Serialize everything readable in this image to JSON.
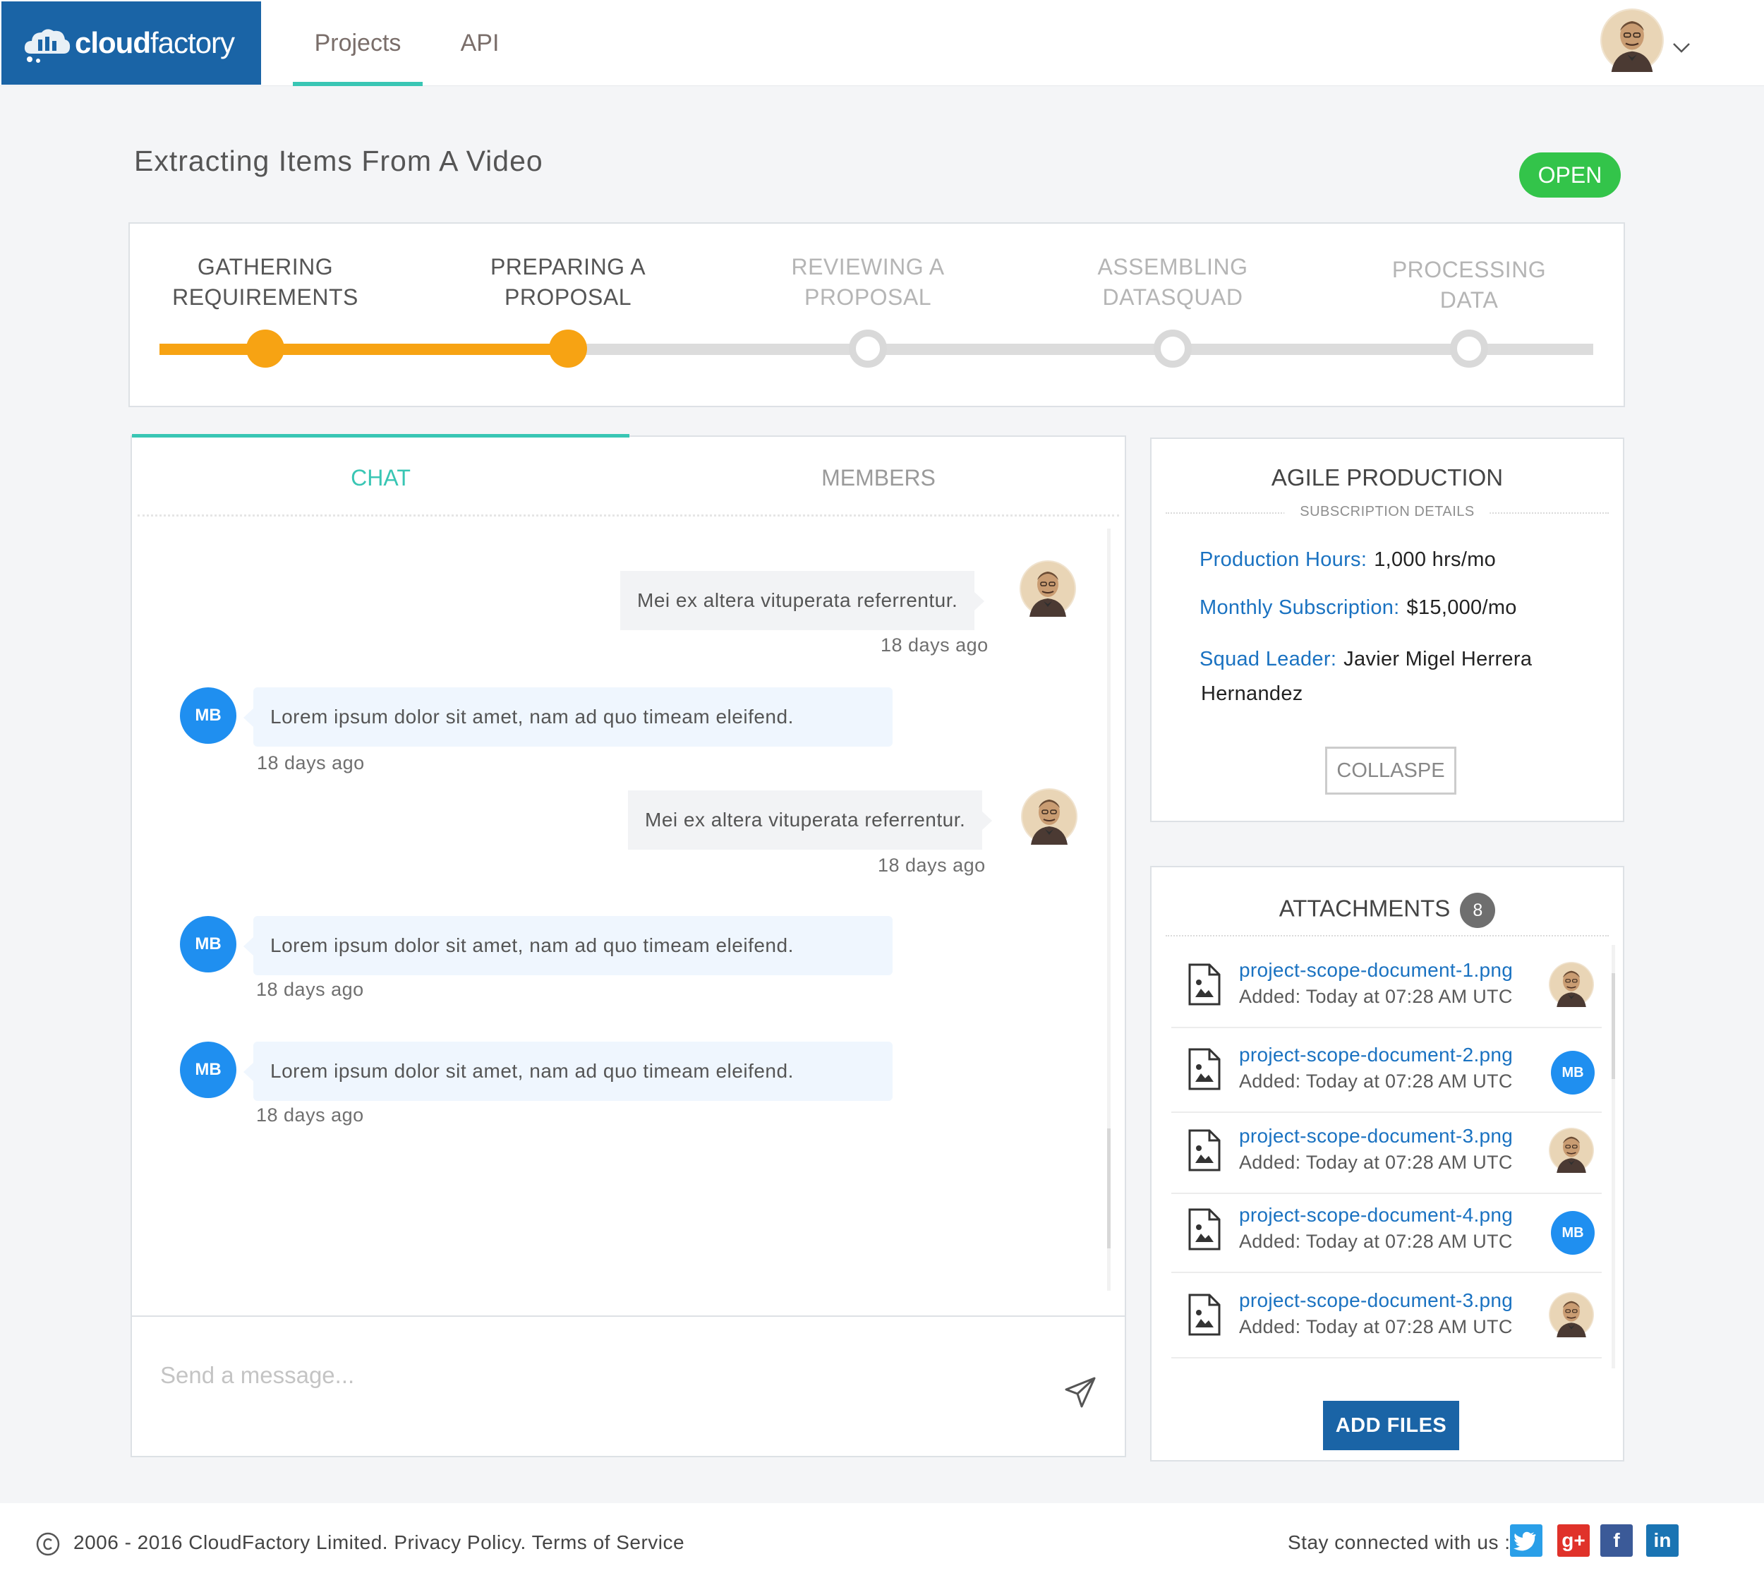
{
  "header": {
    "logo_text_bold": "cloud",
    "logo_text_rest": "factory",
    "nav": [
      {
        "label": "Projects",
        "active": true
      },
      {
        "label": "API",
        "active": false
      }
    ],
    "accent_color": "#39c6b4",
    "brand_color": "#1a64a6"
  },
  "project": {
    "title": "Extracting Items From A Video",
    "status": "OPEN",
    "status_color": "#33c44a"
  },
  "stepper": {
    "progress_fraction": 0.29,
    "steps": [
      {
        "line1": "GATHERING",
        "line2": "REQUIREMENTS",
        "done": true
      },
      {
        "line1": "PREPARING A",
        "line2": "PROPOSAL",
        "done": true
      },
      {
        "line1": "REVIEWING A",
        "line2": "PROPOSAL",
        "done": false
      },
      {
        "line1": "ASSEMBLING",
        "line2": "DATASQUAD",
        "done": false
      },
      {
        "line1": "PROCESSING",
        "line2": "DATA",
        "done": false
      }
    ]
  },
  "chat": {
    "tabs": [
      {
        "label": "CHAT",
        "active": true
      },
      {
        "label": "MEMBERS",
        "active": false
      }
    ],
    "messages": [
      {
        "text": "Mei ex altera vituperata referrentur.",
        "time": "18 days ago",
        "mine": true
      },
      {
        "text": "Lorem ipsum dolor sit amet, nam ad quo timeam eleifend.",
        "time": "18 days ago",
        "mine": false,
        "initials": "MB"
      },
      {
        "text": "Mei ex altera vituperata referrentur.",
        "time": "18 days ago",
        "mine": true
      },
      {
        "text": "Lorem ipsum dolor sit amet, nam ad quo timeam eleifend.",
        "time": "18 days ago",
        "mine": false,
        "initials": "MB"
      },
      {
        "text": "Lorem ipsum dolor sit amet, nam ad quo timeam eleifend.",
        "time": "18 days ago",
        "mine": false,
        "initials": "MB"
      }
    ],
    "compose_placeholder": "Send a message..."
  },
  "subscription": {
    "title": "AGILE PRODUCTION",
    "subtitle": "SUBSCRIPTION DETAILS",
    "details": [
      {
        "label": "Production Hours:",
        "value": "1,000 hrs/mo"
      },
      {
        "label": "Monthly Subscription:",
        "value": "$15,000/mo"
      },
      {
        "label": "Squad Leader:",
        "value": "Javier Migel Herrera"
      }
    ],
    "squad_leader_cont": "Hernandez",
    "collapse_label": "COLLASPE"
  },
  "attachments": {
    "title": "ATTACHMENTS",
    "count": "8",
    "items": [
      {
        "name": "project-scope-document-1.png",
        "added": "Added: Today at 07:28 AM UTC",
        "owner": "photo"
      },
      {
        "name": "project-scope-document-2.png",
        "added": "Added: Today at 07:28 AM UTC",
        "owner": "MB"
      },
      {
        "name": "project-scope-document-3.png",
        "added": "Added: Today at 07:28 AM UTC",
        "owner": "photo"
      },
      {
        "name": "project-scope-document-4.png",
        "added": "Added: Today at 07:28 AM UTC",
        "owner": "MB"
      },
      {
        "name": "project-scope-document-3.png",
        "added": "Added: Today at 07:28 AM UTC",
        "owner": "photo"
      }
    ],
    "add_files_label": "ADD FILES"
  },
  "footer": {
    "copyright": "2006 - 2016 CloudFactory Limited. Privacy Policy. Terms of Service",
    "social_label": "Stay connected with us :",
    "social_icons": [
      "twitter-icon",
      "google-plus-icon",
      "facebook-icon",
      "linkedin-icon"
    ]
  }
}
